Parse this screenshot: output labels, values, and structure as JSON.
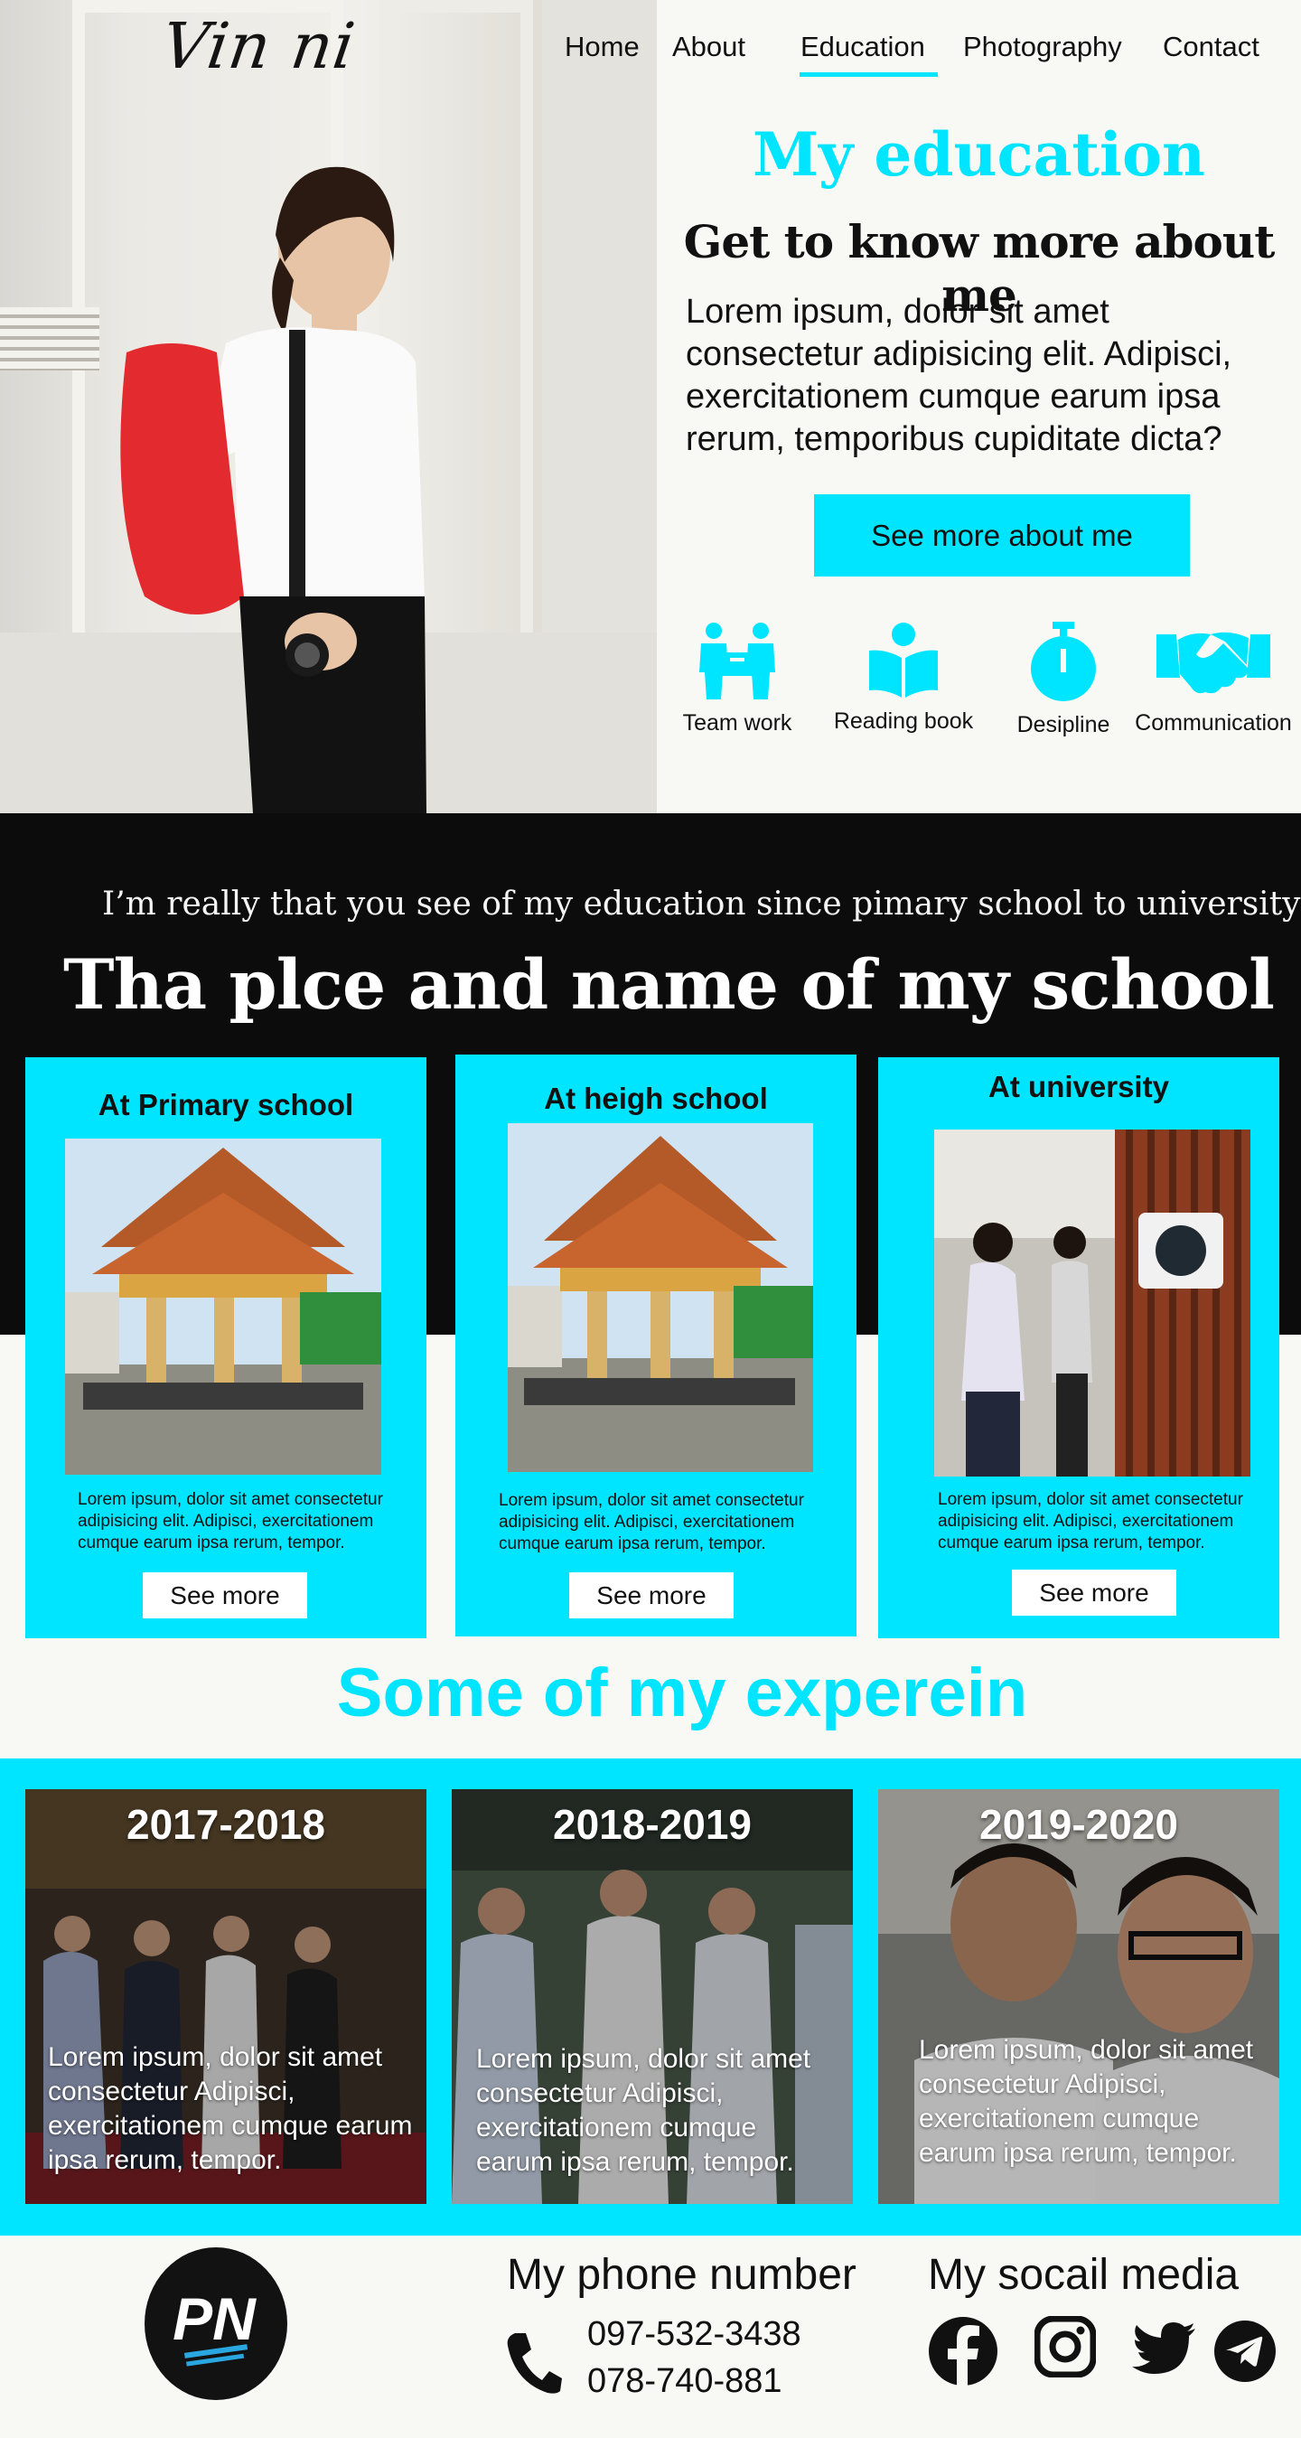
{
  "logo": {
    "text": "Vin ni"
  },
  "nav": {
    "items": [
      {
        "label": "Home"
      },
      {
        "label": "About"
      },
      {
        "label": "Education"
      },
      {
        "label": "Photography"
      },
      {
        "label": "Contact"
      }
    ],
    "active": "Education"
  },
  "education": {
    "title": "My education",
    "subtitle": "Get to know more about me",
    "body": "Lorem ipsum, dolor sit amet consectetur adipisicing elit. Adipisci, exercitationem cumque earum ipsa rerum, temporibus cupiditate dicta?",
    "button": "See more about me"
  },
  "skills": [
    {
      "label": "Team work",
      "icon": "team-work-icon"
    },
    {
      "label": "Reading book",
      "icon": "book-icon"
    },
    {
      "label": "Desipline",
      "icon": "stopwatch-icon"
    },
    {
      "label": "Communication",
      "icon": "handshake-icon"
    }
  ],
  "schools": {
    "intro": "I’m really that you see of my education since pimary school to university",
    "title": "Tha plce and name of my school",
    "cards": [
      {
        "title": "At Primary school",
        "text": "Lorem ipsum, dolor sit amet consectetur adipisicing elit. Adipisci, exercitationem cumque earum ipsa rerum, tempor.",
        "button": "See more"
      },
      {
        "title": "At heigh school",
        "text": "Lorem ipsum, dolor sit amet consectetur adipisicing elit. Adipisci, exercitationem cumque earum ipsa rerum, tempor.",
        "button": "See more"
      },
      {
        "title": "At university",
        "text": "Lorem ipsum, dolor sit amet consectetur adipisicing elit. Adipisci, exercitationem cumque earum ipsa rerum, tempor.",
        "button": "See more"
      }
    ]
  },
  "experience": {
    "title": "Some of my experein",
    "cards": [
      {
        "year": "2017-2018",
        "text": "Lorem ipsum, dolor sit amet consectetur  Adipisci, exercitationem cumque earum ipsa rerum, tempor."
      },
      {
        "year": "2018-2019",
        "text": "Lorem ipsum, dolor sit amet consectetur  Adipisci, exercitationem cumque earum ipsa rerum, tempor."
      },
      {
        "year": "2019-2020",
        "text": "Lorem ipsum, dolor sit amet consectetur  Adipisci, exercitationem cumque earum ipsa rerum, tempor."
      }
    ]
  },
  "footer": {
    "logo_text": "PN",
    "phone_heading": "My phone number",
    "phones": [
      "097-532-3438",
      "078-740-881"
    ],
    "social_heading": "My socail media",
    "social": [
      "facebook-icon",
      "instagram-icon",
      "twitter-icon",
      "telegram-icon"
    ]
  },
  "colors": {
    "accent": "#00e5ff",
    "dark": "#0c0c0c",
    "background": "#f8f8f5"
  }
}
